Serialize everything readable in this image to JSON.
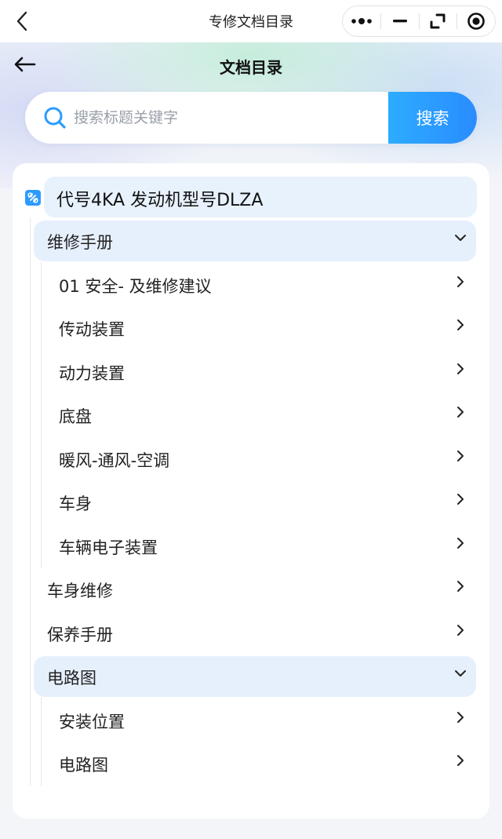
{
  "mini_program": {
    "title": "专修文档目录"
  },
  "header": {
    "title": "文档目录"
  },
  "search": {
    "placeholder": "搜索标题关键字",
    "button_label": "搜索"
  },
  "tree": {
    "root_label": "代号4KA 发动机型号DLZA",
    "sections": [
      {
        "label": "维修手册",
        "expanded": true,
        "children": [
          {
            "label": "01 安全- 及维修建议"
          },
          {
            "label": "传动装置"
          },
          {
            "label": "动力装置"
          },
          {
            "label": "底盘"
          },
          {
            "label": "暖风-通风-空调"
          },
          {
            "label": "车身"
          },
          {
            "label": "车辆电子装置"
          }
        ]
      },
      {
        "label": "车身维修",
        "expanded": false,
        "children": []
      },
      {
        "label": "保养手册",
        "expanded": false,
        "children": []
      },
      {
        "label": "电路图",
        "expanded": true,
        "children": [
          {
            "label": "安装位置"
          },
          {
            "label": "电路图"
          }
        ]
      }
    ]
  },
  "colors": {
    "accent": "#2a9cff",
    "active_row": "#e6f0fd",
    "card": "#ffffff",
    "page_bg": "#f4f5f9"
  },
  "icons": {
    "system_back": "chevron-left-icon",
    "page_back": "arrow-left-icon",
    "search": "search-icon",
    "root": "link-icon",
    "expanded": "chevron-down-icon",
    "collapsed": "chevron-right-icon"
  }
}
